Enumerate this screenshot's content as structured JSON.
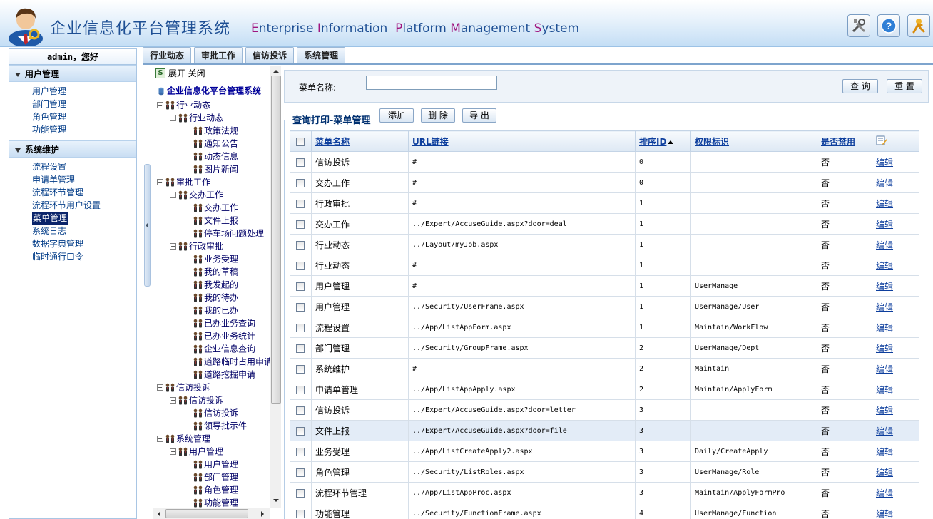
{
  "header": {
    "title_cn": "企业信息化平台管理系统",
    "title_en_words": [
      {
        "cap": "E",
        "rest": "nterprise "
      },
      {
        "cap": "I",
        "rest": "nformation  "
      },
      {
        "cap": "P",
        "rest": "latform "
      },
      {
        "cap": "M",
        "rest": "anagement "
      },
      {
        "cap": "S",
        "rest": "ystem"
      }
    ],
    "buttons": [
      "tools-icon",
      "help-icon",
      "logout-icon"
    ]
  },
  "leftnav": {
    "welcome": "admin，您好",
    "groups": [
      {
        "title": "用户管理",
        "items": [
          "用户管理",
          "部门管理",
          "角色管理",
          "功能管理"
        ]
      },
      {
        "title": "系统维护",
        "items": [
          "流程设置",
          "申请单管理",
          "流程环节管理",
          "流程环节用户设置",
          "菜单管理",
          "系统日志",
          "数据字典管理",
          "临时通行口令"
        ]
      }
    ],
    "active_item": "菜单管理"
  },
  "tabs": [
    "行业动态",
    "审批工作",
    "信访投诉",
    "系统管理"
  ],
  "tree": {
    "toolbar": "展开 关闭",
    "root": "企业信息化平台管理系统",
    "nodes": [
      {
        "level": 1,
        "label": "行业动态",
        "exp": "-"
      },
      {
        "level": 2,
        "label": "行业动态",
        "exp": "-"
      },
      {
        "level": 3,
        "label": "政策法规"
      },
      {
        "level": 3,
        "label": "通知公告"
      },
      {
        "level": 3,
        "label": "动态信息"
      },
      {
        "level": 3,
        "label": "图片新闻"
      },
      {
        "level": 1,
        "label": "审批工作",
        "exp": "-"
      },
      {
        "level": 2,
        "label": "交办工作",
        "exp": "-"
      },
      {
        "level": 3,
        "label": "交办工作"
      },
      {
        "level": 3,
        "label": "文件上报"
      },
      {
        "level": 3,
        "label": "停车场问题处理"
      },
      {
        "level": 2,
        "label": "行政审批",
        "exp": "-"
      },
      {
        "level": 3,
        "label": "业务受理"
      },
      {
        "level": 3,
        "label": "我的草稿"
      },
      {
        "level": 3,
        "label": "我发起的"
      },
      {
        "level": 3,
        "label": "我的待办"
      },
      {
        "level": 3,
        "label": "我的已办"
      },
      {
        "level": 3,
        "label": "已办业务查询"
      },
      {
        "level": 3,
        "label": "已办业务统计"
      },
      {
        "level": 3,
        "label": "企业信息查询"
      },
      {
        "level": 3,
        "label": "道路临时占用申请"
      },
      {
        "level": 3,
        "label": "道路挖掘申请"
      },
      {
        "level": 1,
        "label": "信访投诉",
        "exp": "-"
      },
      {
        "level": 2,
        "label": "信访投诉",
        "exp": "-"
      },
      {
        "level": 3,
        "label": "信访投诉"
      },
      {
        "level": 3,
        "label": "领导批示件"
      },
      {
        "level": 1,
        "label": "系统管理",
        "exp": "-"
      },
      {
        "level": 2,
        "label": "用户管理",
        "exp": "-"
      },
      {
        "level": 3,
        "label": "用户管理"
      },
      {
        "level": 3,
        "label": "部门管理"
      },
      {
        "level": 3,
        "label": "角色管理"
      },
      {
        "level": 3,
        "label": "功能管理"
      }
    ]
  },
  "search": {
    "label": "菜单名称:",
    "value": "",
    "query_button": "查 询",
    "reset_button": "重 置"
  },
  "grid": {
    "title": "查询打印-菜单管理",
    "add_button": "添加",
    "delete_button": "删 除",
    "export_button": "导 出",
    "columns": [
      "菜单名称",
      "URL链接",
      "排序ID",
      "权限标识",
      "是否禁用"
    ],
    "sorted_column": "排序ID",
    "edit_label": "编辑",
    "highlighted_row": 13,
    "rows": [
      [
        "信访投诉",
        "#",
        "0",
        "",
        "否"
      ],
      [
        "交办工作",
        "#",
        "0",
        "",
        "否"
      ],
      [
        "行政审批",
        "#",
        "1",
        "",
        "否"
      ],
      [
        "交办工作",
        "../Expert/AccuseGuide.aspx?door=deal",
        "1",
        "",
        "否"
      ],
      [
        "行业动态",
        "../Layout/myJob.aspx",
        "1",
        "",
        "否"
      ],
      [
        "行业动态",
        "#",
        "1",
        "",
        "否"
      ],
      [
        "用户管理",
        "#",
        "1",
        "UserManage",
        "否"
      ],
      [
        "用户管理",
        "../Security/UserFrame.aspx",
        "1",
        "UserManage/User",
        "否"
      ],
      [
        "流程设置",
        "../App/ListAppForm.aspx",
        "1",
        "Maintain/WorkFlow",
        "否"
      ],
      [
        "部门管理",
        "../Security/GroupFrame.aspx",
        "2",
        "UserManage/Dept",
        "否"
      ],
      [
        "系统维护",
        "#",
        "2",
        "Maintain",
        "否"
      ],
      [
        "申请单管理",
        "../App/ListAppApply.aspx",
        "2",
        "Maintain/ApplyForm",
        "否"
      ],
      [
        "信访投诉",
        "../Expert/AccuseGuide.aspx?door=letter",
        "3",
        "",
        "否"
      ],
      [
        "文件上报",
        "../Expert/AccuseGuide.aspx?door=file",
        "3",
        "",
        "否"
      ],
      [
        "业务受理",
        "../App/ListCreateApply2.aspx",
        "3",
        "Daily/CreateApply",
        "否"
      ],
      [
        "角色管理",
        "../Security/ListRoles.aspx",
        "3",
        "UserManage/Role",
        "否"
      ],
      [
        "流程环节管理",
        "../App/ListAppProc.aspx",
        "3",
        "Maintain/ApplyFormPro",
        "否"
      ],
      [
        "功能管理",
        "../Security/FunctionFrame.aspx",
        "4",
        "UserManage/Function",
        "否"
      ]
    ]
  }
}
